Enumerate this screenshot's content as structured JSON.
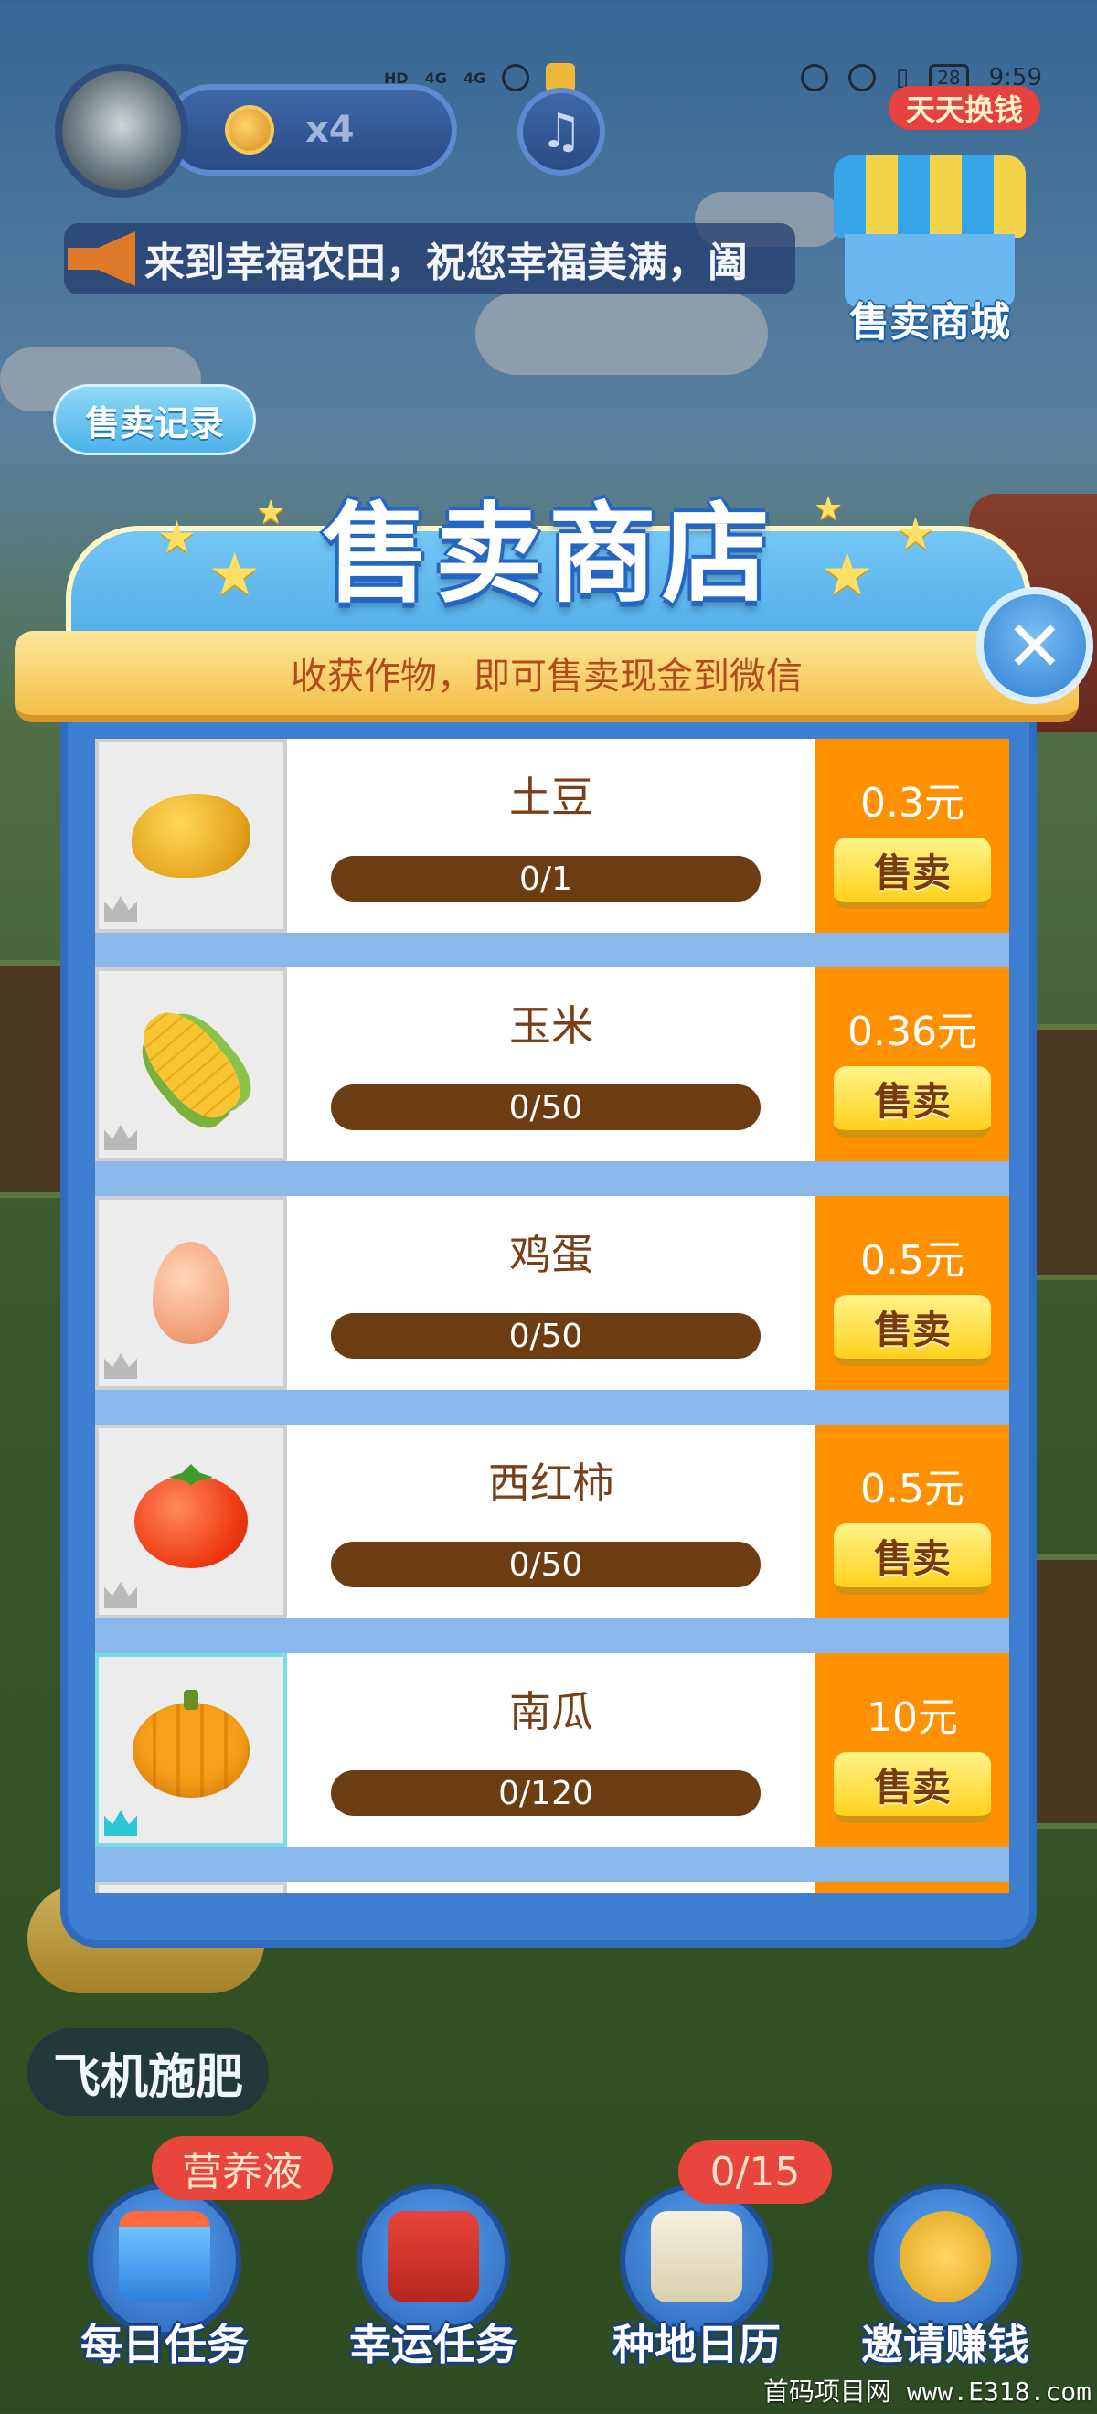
{
  "status_bar": {
    "network_labels": [
      "HD",
      "4G",
      "4G"
    ],
    "battery": "28",
    "time": "9:59"
  },
  "hud": {
    "potion_count": "x4",
    "ticker_text": "来到幸福农田，祝您幸福美满，阖",
    "shop_badge": "天天换钱",
    "sell_mall_label": "售卖商城",
    "sell_record_label": "售卖记录"
  },
  "modal": {
    "title": "售卖商店",
    "subtitle": "收获作物，即可售卖现金到微信",
    "close_symbol": "✕",
    "sell_label": "售卖",
    "items": [
      {
        "name": "土豆",
        "progress": "0/1",
        "price": "0.3元",
        "icon": "potato-icon"
      },
      {
        "name": "玉米",
        "progress": "0/50",
        "price": "0.36元",
        "icon": "corn-icon"
      },
      {
        "name": "鸡蛋",
        "progress": "0/50",
        "price": "0.5元",
        "icon": "egg-icon"
      },
      {
        "name": "西红柿",
        "progress": "0/50",
        "price": "0.5元",
        "icon": "tomato-icon"
      },
      {
        "name": "南瓜",
        "progress": "0/120",
        "price": "10元",
        "icon": "pumpkin-icon"
      }
    ]
  },
  "bottom": {
    "fertilize_label": "飞机施肥",
    "nav": [
      {
        "label": "每日任务",
        "badge": "营养液"
      },
      {
        "label": "幸运任务",
        "badge": ""
      },
      {
        "label": "种地日历",
        "badge": "0/15"
      },
      {
        "label": "邀请赚钱",
        "badge": ""
      }
    ]
  },
  "watermark": "首码项目网 www.E318.com"
}
